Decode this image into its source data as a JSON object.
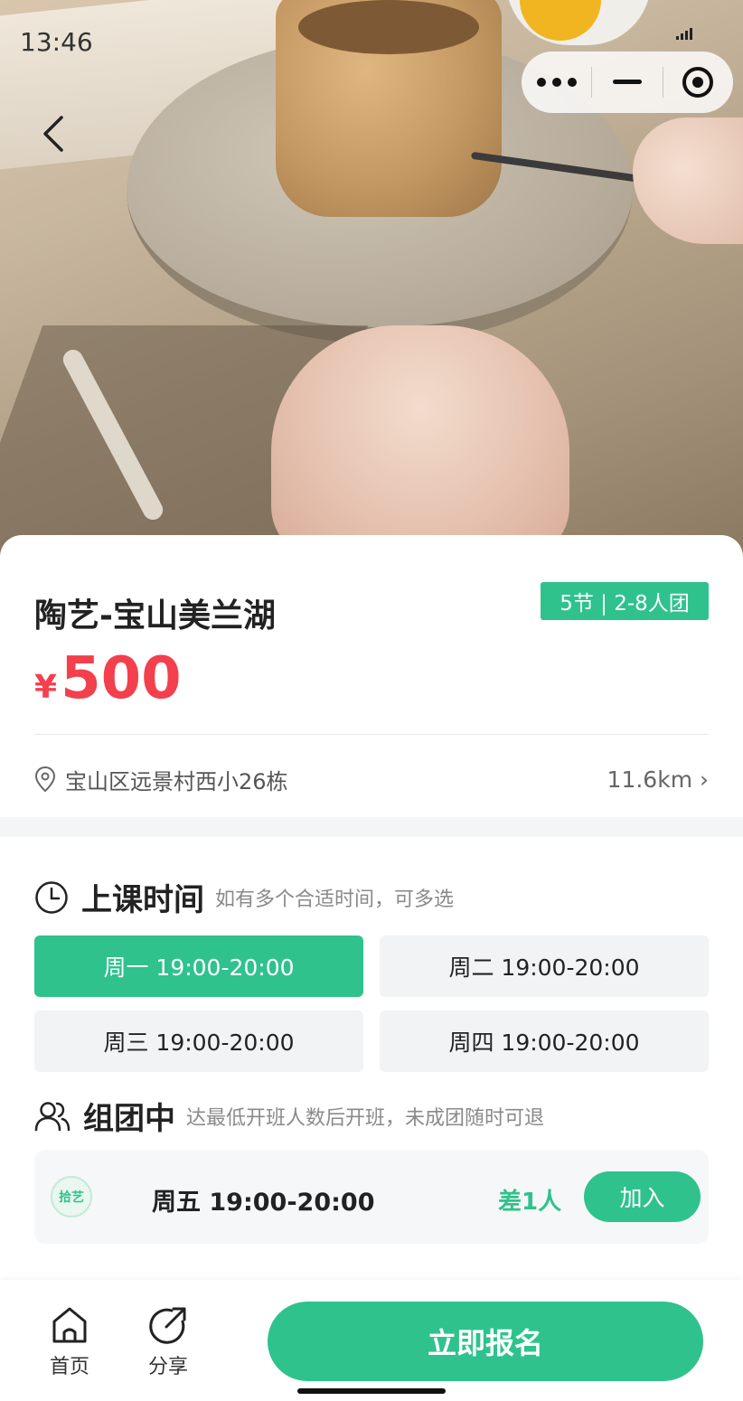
{
  "status_bar": {
    "time": "13:46"
  },
  "product": {
    "title": "陶艺-宝山美兰湖",
    "tag": "5节 | 2-8人团",
    "currency": "¥",
    "price": "500",
    "address": "宝山区远景村西小26栋",
    "distance": "11.6km ›"
  },
  "schedule": {
    "title": "上课时间",
    "subtitle": "如有多个合适时间，可多选",
    "slots": [
      {
        "label": "周一 19:00-20:00",
        "selected": true
      },
      {
        "label": "周二 19:00-20:00",
        "selected": false
      },
      {
        "label": "周三 19:00-20:00",
        "selected": false
      },
      {
        "label": "周四 19:00-20:00",
        "selected": false
      }
    ]
  },
  "group": {
    "title": "组团中",
    "subtitle": "达最低开班人数后开班，未成团随时可退",
    "items": [
      {
        "logo_text": "拾艺",
        "time": "周五 19:00-20:00",
        "need": "差1人",
        "join_label": "加入"
      }
    ]
  },
  "bottom_bar": {
    "home_label": "首页",
    "share_label": "分享",
    "cta_label": "立即报名"
  },
  "colors": {
    "accent": "#2fc28d",
    "price": "#f43f4c",
    "bg_gray": "#f4f5f7"
  }
}
